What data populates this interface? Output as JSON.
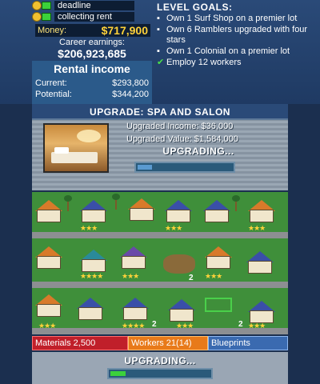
{
  "hud": {
    "status1": "deadline",
    "status2": "collecting rent",
    "money_label": "Money:",
    "money_value": "$717,900",
    "career_label": "Career earnings:",
    "career_value": "$206,923,685",
    "rental_title": "Rental income",
    "current_label": "Current:",
    "current_value": "$293,800",
    "potential_label": "Potential:",
    "potential_value": "$344,200"
  },
  "goals": {
    "title": "LEVEL GOALS:",
    "items": [
      {
        "text": "Own 1 Surf Shop on a premier lot",
        "done": false
      },
      {
        "text": "Own 6 Ramblers upgraded with four stars",
        "done": false
      },
      {
        "text": "Own 1 Colonial on a premier lot",
        "done": false
      },
      {
        "text": "Employ 12 workers",
        "done": true
      }
    ]
  },
  "upgrade": {
    "title": "UPGRADE: SPA AND SALON",
    "income": "Upgraded Income: $36,000",
    "value": "Upgraded Value: $1,584,000",
    "status": "UPGRADING...",
    "progress": 0.15
  },
  "map": {
    "lot_numbers": [
      "2",
      "2",
      "2"
    ],
    "stars": [
      "★★★",
      "★★★",
      "★★★",
      "★★★★",
      "★★★",
      "★★★",
      "★★★",
      "★★★★",
      "★★★",
      "★★★"
    ]
  },
  "resources": {
    "materials": "Materials 2,500",
    "workers": "Workers  21(14)",
    "blueprints": "Blueprints"
  },
  "bottom": {
    "status": "UPGRADING...",
    "progress": 0.15
  },
  "colors": {
    "panel": "#2a4a78",
    "money": "#ffd23a",
    "materials": "#c01f2a",
    "workers": "#e87a1a",
    "blueprints": "#3a6ab0",
    "progress_green": "#3bd13b"
  }
}
